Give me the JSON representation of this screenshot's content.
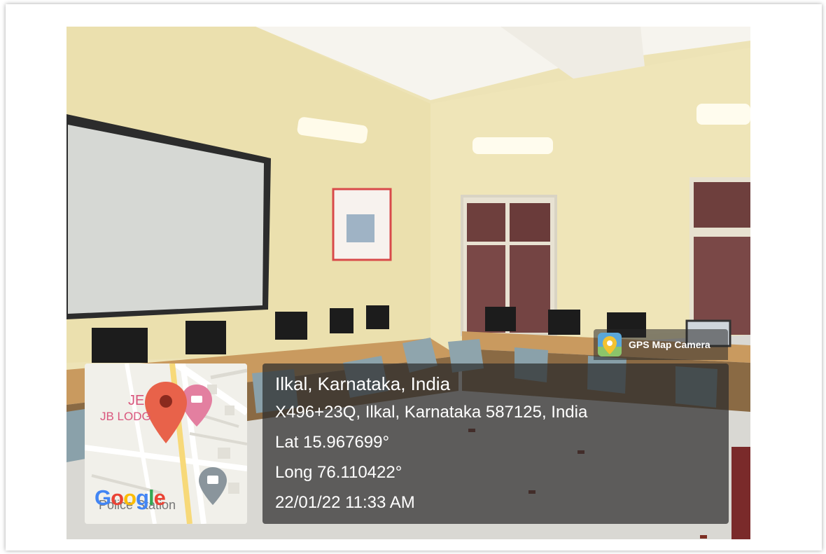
{
  "overlay": {
    "title": "Ilkal, Karnataka, India",
    "address": "X496+23Q, Ilkal, Karnataka 587125, India",
    "latitude": "Lat 15.967699°",
    "longitude": "Long 76.110422°",
    "datetime": "22/01/22 11:33 AM"
  },
  "badge": {
    "label": "GPS Map Camera",
    "icon": "camera-pin-icon"
  },
  "map": {
    "poi_1": "JE",
    "poi_2": "JB LODG",
    "poi_3": "Police Station",
    "logo": "Google",
    "marker_icon": "map-pin-icon",
    "marker_color": "#e8624a",
    "poi_pin_color": "#e37fa0"
  },
  "colors": {
    "wall": "#ede3b6",
    "overlay_bg": "#2d2d2d"
  }
}
